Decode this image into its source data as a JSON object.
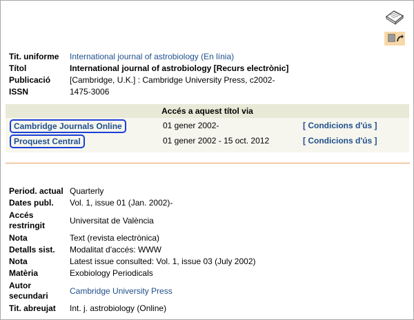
{
  "icons": {
    "top": "book-icon",
    "tools": "tools-icon",
    "accent_bg": "#f7d8a8"
  },
  "record": {
    "rows": [
      {
        "label": "Tit. uniforme",
        "value": "International journal of astrobiology (En línia)"
      },
      {
        "label": "Títol",
        "value": "International journal of astrobiology [Recurs electrònic]"
      },
      {
        "label": "Publicació",
        "value": "[Cambridge, U.K.] : Cambridge University Press, c2002-"
      },
      {
        "label": "ISSN",
        "value": "1475-3006"
      }
    ]
  },
  "access": {
    "title": "Accés a aquest títol via",
    "items": [
      {
        "name": "Cambridge Journals Online",
        "date": "01 gener 2002-",
        "conditions": "[ Condicions d'ús ]"
      },
      {
        "name": "Proquest Central",
        "date": "01 gener 2002 - 15 oct. 2012",
        "conditions": "[ Condicions d'ús ]"
      }
    ]
  },
  "details": {
    "rows": [
      {
        "label": "Period. actual",
        "value": "Quarterly"
      },
      {
        "label": "Dates publ.",
        "value": "Vol. 1, issue 01 (Jan. 2002)-"
      },
      {
        "label_line1": "Accés",
        "label_line2": "restringit",
        "value": "Universitat de València"
      },
      {
        "label": "Nota",
        "value": "Text (revista electrònica)"
      },
      {
        "label": "Detalls sist.",
        "value": "Modalitat d'accés: WWW"
      },
      {
        "label": "Nota",
        "value": "Latest issue consulted: Vol. 1, issue 03 (July 2002)"
      },
      {
        "label": "Matèria",
        "value": "Exobiology Periodicals"
      },
      {
        "label_line1": "Autor",
        "label_line2": "secundari",
        "value": "Cambridge University Press"
      },
      {
        "label": "Tit. abreujat",
        "value": "Int. j. astrobiology (Online)"
      }
    ]
  },
  "colors": {
    "link": "#1f4e8c",
    "highlight_border": "#1a3fd6",
    "divider": "#e79b5a"
  }
}
